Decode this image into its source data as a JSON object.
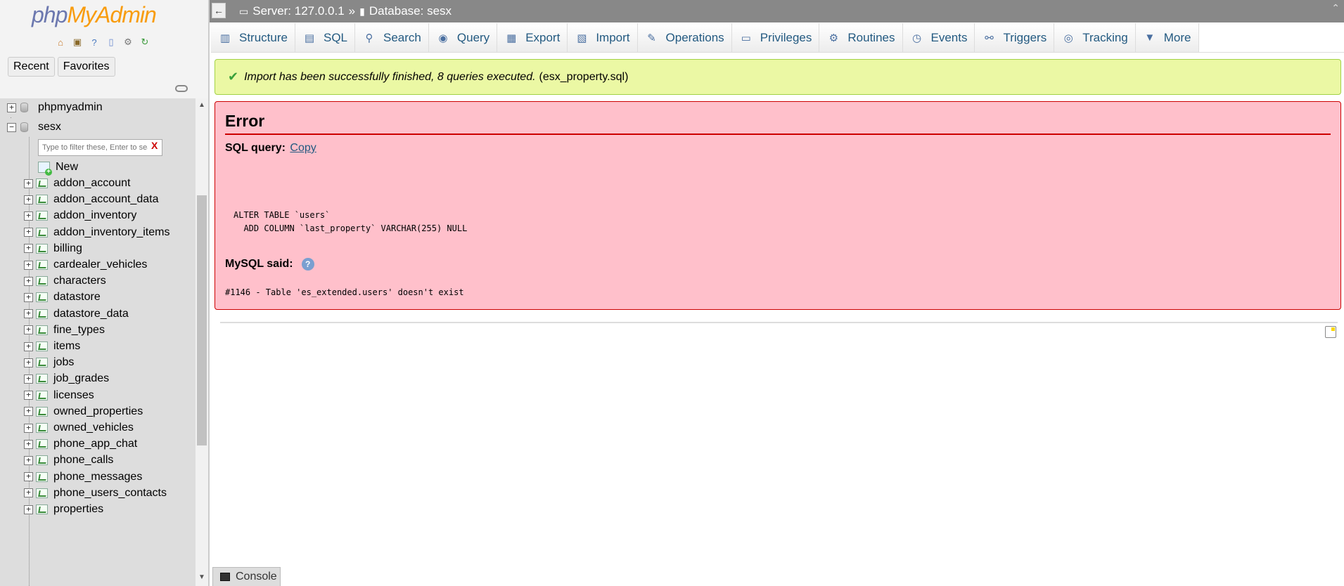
{
  "logo": {
    "php": "php",
    "myadmin": "MyAdmin"
  },
  "nav": {
    "tabs": [
      "Recent",
      "Favorites"
    ],
    "databases": [
      {
        "name": "phpmyadmin",
        "expander": "+"
      },
      {
        "name": "sesx",
        "expander": "−"
      }
    ],
    "filter_placeholder": "Type to filter these, Enter to search all",
    "filter_clear": "X",
    "new_label": "New",
    "tables": [
      "addon_account",
      "addon_account_data",
      "addon_inventory",
      "addon_inventory_items",
      "billing",
      "cardealer_vehicles",
      "characters",
      "datastore",
      "datastore_data",
      "fine_types",
      "items",
      "jobs",
      "job_grades",
      "licenses",
      "owned_properties",
      "owned_vehicles",
      "phone_app_chat",
      "phone_calls",
      "phone_messages",
      "phone_users_contacts",
      "properties"
    ]
  },
  "topbar": {
    "server": "Server: 127.0.0.1",
    "separator": "»",
    "database": "Database: sesx"
  },
  "tabs": [
    {
      "label": "Structure",
      "icon": "structure-icon",
      "glyph": "▥"
    },
    {
      "label": "SQL",
      "icon": "sql-icon",
      "glyph": "▤"
    },
    {
      "label": "Search",
      "icon": "search-icon",
      "glyph": "⚲"
    },
    {
      "label": "Query",
      "icon": "query-icon",
      "glyph": "◉"
    },
    {
      "label": "Export",
      "icon": "export-icon",
      "glyph": "▦"
    },
    {
      "label": "Import",
      "icon": "import-icon",
      "glyph": "▧"
    },
    {
      "label": "Operations",
      "icon": "operations-icon",
      "glyph": "✎"
    },
    {
      "label": "Privileges",
      "icon": "privileges-icon",
      "glyph": "▭"
    },
    {
      "label": "Routines",
      "icon": "routines-icon",
      "glyph": "⚙"
    },
    {
      "label": "Events",
      "icon": "events-icon",
      "glyph": "◷"
    },
    {
      "label": "Triggers",
      "icon": "triggers-icon",
      "glyph": "⚯"
    },
    {
      "label": "Tracking",
      "icon": "tracking-icon",
      "glyph": "◎"
    },
    {
      "label": "More",
      "icon": "chevron-down-icon",
      "glyph": "▼"
    }
  ],
  "success": {
    "message": "Import has been successfully finished, 8 queries executed.",
    "file": "(esx_property.sql)"
  },
  "error": {
    "title": "Error",
    "sql_query_label": "SQL query:",
    "copy_label": "Copy",
    "sql_code": "ALTER TABLE `users`\n  ADD COLUMN `last_property` VARCHAR(255) NULL",
    "mysql_said": "MySQL said:",
    "message": "#1146 - Table 'es_extended.users' doesn't exist"
  },
  "console": {
    "label": "Console"
  }
}
